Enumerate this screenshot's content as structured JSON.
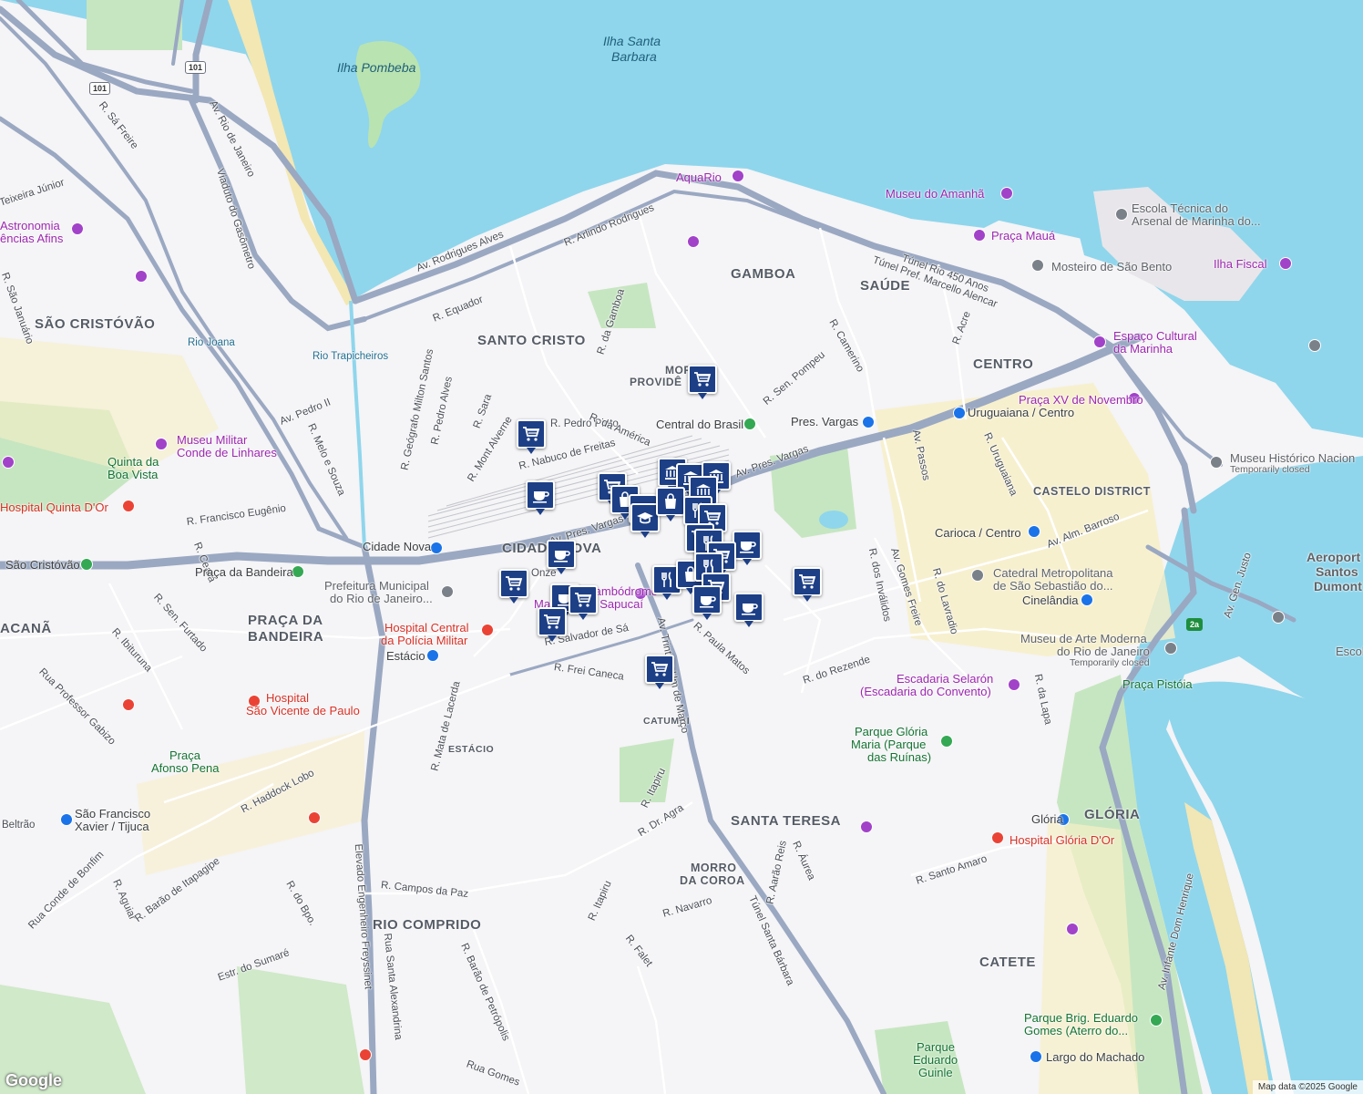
{
  "districts": [
    "SÃO CRISTÓVÃO",
    "SANTO CRISTO",
    "GAMBOA",
    "SAÚDE",
    "CENTRO",
    "MORRO",
    "PROVIDÊ",
    "CIDADE NOVA",
    "PRAÇA DA",
    "BANDEIRA",
    "CASTELO DISTRICT",
    "ESTÁCIO",
    "CATUMBI",
    "SANTA TERESA",
    "MORRO",
    "DA COROA",
    "RIO COMPRIDO",
    "GLÓRIA",
    "CATETE",
    "ACANÃ"
  ],
  "water": [
    "Ilha Pombeba",
    "Ilha Santa",
    "Barbara"
  ],
  "streets": [
    "Av. Rodrigues Alves",
    "R. Arlindo Rodrigues",
    "R. Equador",
    "Av. Rio de Janeiro",
    "Viaduto do Gasômetro",
    "R. Sá Freire",
    "R. São Januário",
    "Av. Pedro II",
    "R. Melo e Souza",
    "R. Geógrafo Milton Santos",
    "R. Pedro Alves",
    "R. Sara",
    "R. Mont Alverne",
    "R. Nabuco de Freitas",
    "R. Pedro Pinto",
    "R. da América",
    "R. da Gamboa",
    "R. Sen. Pompeu",
    "R. Camerino",
    "R. Acre",
    "R. Uruguaiana",
    "Av. Passos",
    "Av. Pres. Vargas",
    "Av. Pres. Vargas",
    "Av. Alm. Barroso",
    "Av. Gomes Freire",
    "R. do Lavradio",
    "R. dos Inválidos",
    "R. Francisco Eugênio",
    "R. Ceará",
    "R. Sen. Furtado",
    "R. Ibituruna",
    "Rua Professor Gabizo",
    "R. Frei Caneca",
    "R. Salvador de Sá",
    "Av. Trinta e Um de Março",
    "R. Paula Matos",
    "R. do Rezende",
    "R. Itapiru",
    "R. Dr. Agra",
    "R. Haddock Lobo",
    "R. Mata de Lacerda",
    "R. Campos da Paz",
    "Elevado Engenheiro Freyssinet",
    "Rua Santa Alexandrina",
    "R. Barão de Petrópolis",
    "R. Itapiru",
    "R. Navarro",
    "R. Falet",
    "Túnel Santa Bárbara",
    "R. Aarão Reis",
    "R. Áurea",
    "R. Santo Amaro",
    "R. da Lapa",
    "Av. Infante Dom Henrique",
    "Av. Gen. Justo",
    "Estr. do Sumaré",
    "Rua Gomes",
    "R. do Bpo.",
    "R. Aguiar",
    "R. Barão de Itapagipe",
    "Rua Conde de Bonfim",
    "Túnel Rio 450 Anos",
    "Túnel Pref. Marcello Alencar",
    "Beltrão",
    "Rio Joana",
    "Rio Trapicheiros",
    "Teixeira Júnior",
    "Onze"
  ],
  "pois": {
    "aquario": "AquaRio",
    "museu_amanha": "Museu do Amanhã",
    "escola_tecnica": "Escola Técnica do",
    "escola_tecnica2": "Arsenal de Marinha do...",
    "praca_maua": "Praça Mauá",
    "mosteiro": "Mosteiro de São Bento",
    "ilha_fiscal": "Ilha Fiscal",
    "espaco_cultural": "Espaço Cultural",
    "espaco_cultural2": "da Marinha",
    "praca_xv": "Praça XV de Novembro",
    "uruguaiana": "Uruguaiana / Centro",
    "pres_vargas": "Pres. Vargas",
    "central_brasil": "Central do Brasil",
    "museu_historico": "Museu Histórico Nacion",
    "museu_historico_sub": "Temporarily closed",
    "carioca": "Carioca / Centro",
    "catedral": "Catedral Metropolitana",
    "catedral2": "de São Sebastião do...",
    "cinelandia": "Cinelândia",
    "aeroporto": "Aeroport",
    "aeroporto2": "Santos",
    "aeroporto3": "Dumont",
    "museu_arte": "Museu de Arte Moderna",
    "museu_arte2": "do Rio de Janeiro",
    "museu_arte_sub": "Temporarily closed",
    "praca_pistoia": "Praça Pistóia",
    "escadaria": "Escadaria Selarón",
    "escadaria2": "(Escadaria do Convento)",
    "parque_gloria": "Parque Glória",
    "parque_gloria2": "Maria (Parque",
    "parque_gloria3": "das Ruínas)",
    "gloria_station": "Glória",
    "hospital_gloria": "Hospital Glória D'Or",
    "parque_brig": "Parque Brig. Eduardo",
    "parque_brig2": "Gomes (Aterro do...",
    "largo_machado": "Largo do Machado",
    "parque_guinle": "Parque",
    "parque_guinle2": "Eduardo",
    "parque_guinle3": "Guinle",
    "cidade_nova_st": "Cidade Nova",
    "praca_bandeira_st": "Praça da Bandeira",
    "sao_cristovao_st": "São Cristóvão",
    "prefeitura": "Prefeitura Municipal",
    "prefeitura2": "do Rio de Janeiro...",
    "hospital_pm": "Hospital Central",
    "hospital_pm2": "da Polícia Militar",
    "estacio_st": "Estácio",
    "sambodromo": "Sambódromo",
    "sambodromo2": "Marquês de Sapucaí",
    "hospital_svp": "Hospital",
    "hospital_svp2": "São Vicente de Paulo",
    "praca_afonso": "Praça",
    "praca_afonso2": "Afonso Pena",
    "sao_francisco": "São Francisco",
    "sao_francisco2": "Xavier / Tijuca",
    "museu_militar": "Museu Militar",
    "museu_militar2": "Conde de Linhares",
    "quinta": "Quinta da",
    "quinta2": "Boa Vista",
    "hospital_quinta": "Hospital Quinta D'Or",
    "astronomia": "Astronomia",
    "astronomia2": "ências Afins",
    "escol": "Escol"
  },
  "shields": [
    "101",
    "101",
    "2a"
  ],
  "footer": "Map data ©2025 Google",
  "google": "Google"
}
